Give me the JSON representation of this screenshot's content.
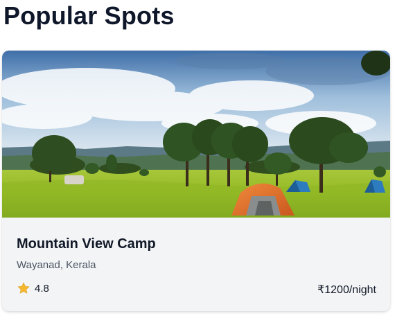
{
  "section": {
    "title": "Popular Spots"
  },
  "card": {
    "title": "Mountain View Camp",
    "location": "Wayanad, Kerala",
    "rating": "4.8",
    "price": "₹1200/night",
    "image_icon": "campsite-photo",
    "rating_icon": "star-icon"
  },
  "colors": {
    "card_background": "#f3f4f6",
    "star": "#f5b82e",
    "text_primary": "#111827",
    "text_secondary": "#4b5563"
  }
}
